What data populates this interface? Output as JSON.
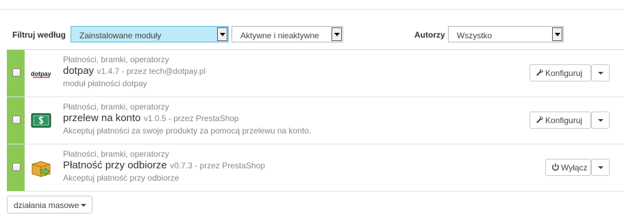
{
  "filters": {
    "filter_label": "Filtruj według",
    "type_select": "Zainstalowane moduły",
    "status_select": "Aktywne i nieaktywne",
    "authors_label": "Autorzy",
    "authors_select": "Wszystko"
  },
  "modules": [
    {
      "category": "Płatności, bramki, operatorzy",
      "name": "dotpay",
      "version": "v1.4.7 - przez tech@dotpay.pl",
      "description": "moduł płatności dotpay",
      "action": "Konfiguruj",
      "action_icon": "wrench-icon",
      "logo": "dotpay-logo",
      "logo_text": "dotpay"
    },
    {
      "category": "Płatności, bramki, operatorzy",
      "name": "przelew na konto",
      "version": "v1.0.5 - przez PrestaShop",
      "description": "Akceptuj płatności za swoje produkty za pomocą przelewu na konto.",
      "action": "Konfiguruj",
      "action_icon": "wrench-icon",
      "logo": "banknote-dollar-icon"
    },
    {
      "category": "Płatności, bramki, operatorzy",
      "name": "Płatność przy odbiorze",
      "version": "v0.7.3 - przez PrestaShop",
      "description": "Akceptuj płatność przy odbiorze",
      "action": "Wyłącz",
      "action_icon": "power-icon",
      "logo": "box-arrow-icon"
    }
  ],
  "bulk": {
    "label": "działania masowe"
  },
  "colors": {
    "active_bar": "#8bc954",
    "selected_filter_bg": "#bde9f8"
  }
}
